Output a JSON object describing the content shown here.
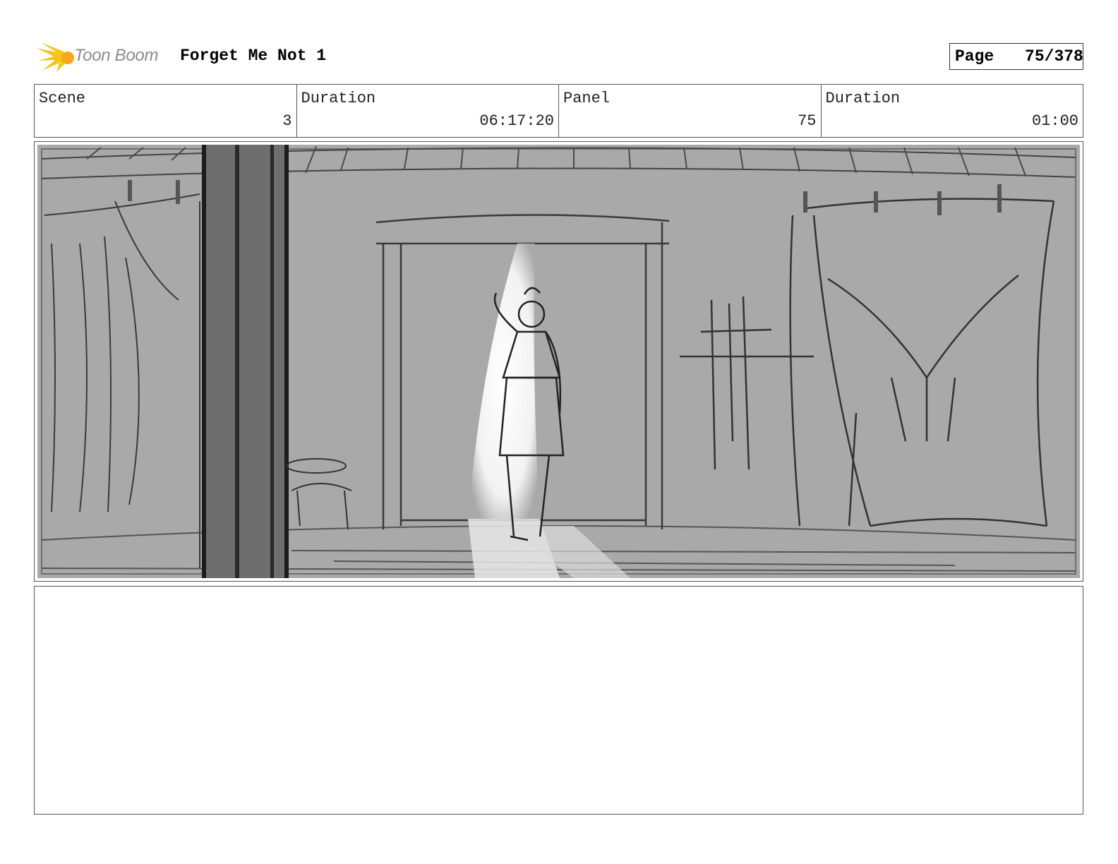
{
  "header": {
    "logo_text": "Toon Boom",
    "project_title": "Forget Me Not 1",
    "page_label": "Page",
    "page_number": "75/378"
  },
  "info": {
    "scene_label": "Scene",
    "scene_value": "3",
    "scene_duration_label": "Duration",
    "scene_duration_value": "06:17:20",
    "panel_label": "Panel",
    "panel_value": "75",
    "panel_duration_label": "Duration",
    "panel_duration_value": "01:00"
  },
  "colors": {
    "logo_accent": "#f5c518",
    "sketch_bg": "#a9a9a9",
    "sketch_line": "#333333",
    "door_light": "#ffffff"
  },
  "panel": {
    "icon": "storyboard-sketch"
  }
}
